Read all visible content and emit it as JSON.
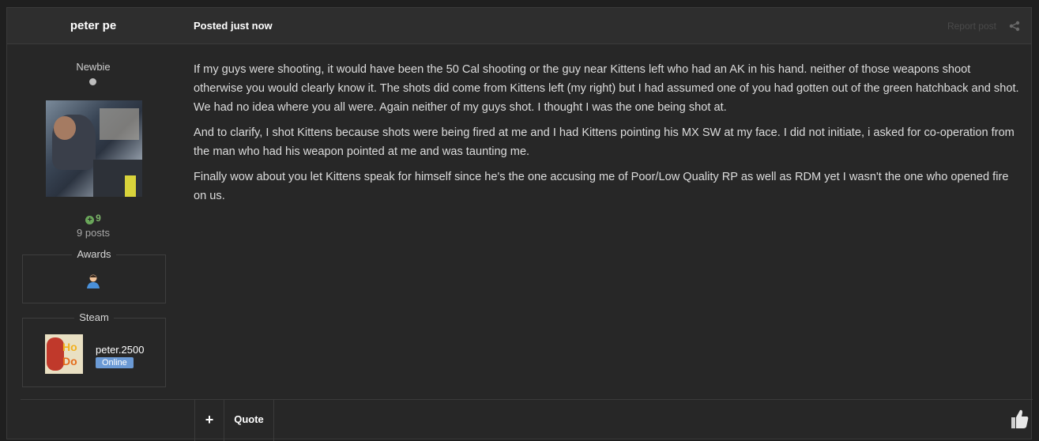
{
  "post": {
    "author": "peter pe",
    "posted": "Posted just now",
    "report_label": "Report post",
    "share_icon": "share-icon"
  },
  "author_panel": {
    "rank": "Newbie",
    "reputation": "9",
    "post_count": "9 posts",
    "awards_title": "Awards",
    "award_icon": "person-award-icon",
    "steam_title": "Steam",
    "steam_name": "peter.2500",
    "steam_status": "Online"
  },
  "content": {
    "paragraphs": [
      "If my guys were shooting, it would have been the 50 Cal shooting or the guy near Kittens left who had an AK in his hand. neither of those weapons shoot otherwise you would clearly know it. The shots did come from Kittens left (my right) but I had assumed one of you had gotten out of the green hatchback and shot. We had no idea where you all were.  Again neither of my guys shot. I thought I was the one being shot at.",
      "And to clarify, I shot Kittens because shots were being fired at me and I had Kittens pointing his MX SW at my face. I did not initiate, i asked for co-operation from the man who had his weapon pointed at me and was taunting me.",
      "Finally wow about you let Kittens speak for himself since he's the one accusing me of Poor/Low Quality RP as well as RDM yet I wasn't the one who opened fire on us."
    ]
  },
  "footer": {
    "plus_label": "+",
    "quote_label": "Quote",
    "like_icon": "thumbs-up-icon"
  }
}
